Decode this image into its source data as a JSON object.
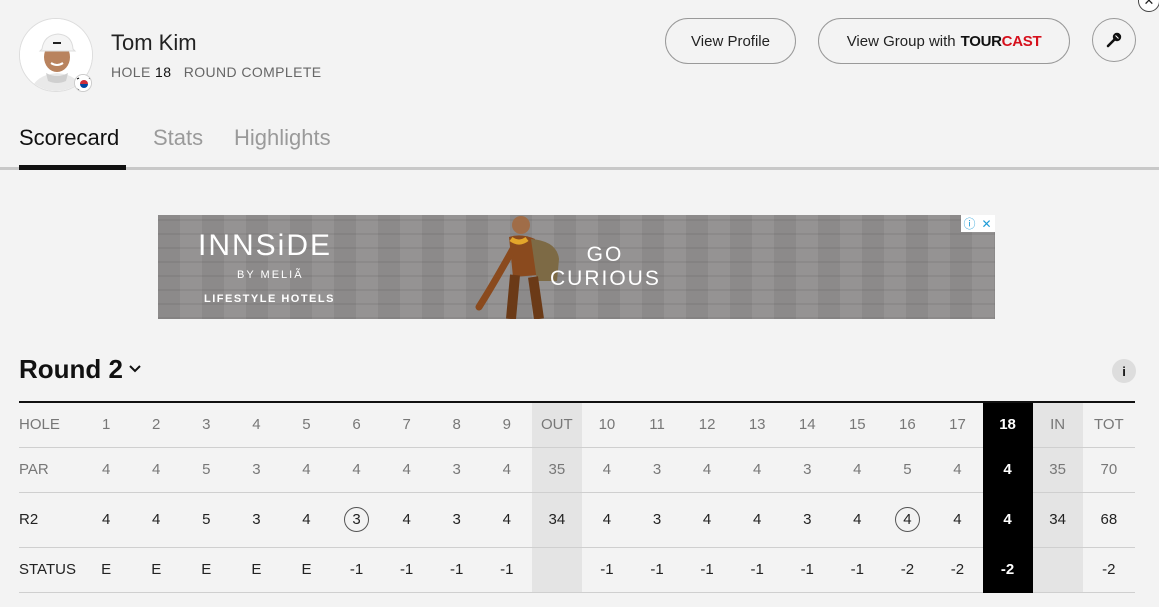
{
  "player": {
    "name": "Tom Kim",
    "hole_label": "HOLE",
    "hole_number": "18",
    "status": "ROUND COMPLETE"
  },
  "buttons": {
    "view_profile": "View Profile",
    "view_group": "View Group with",
    "tourcast_tour": "TOUR",
    "tourcast_cast": "CAST"
  },
  "tabs": [
    {
      "label": "Scorecard",
      "active": true
    },
    {
      "label": "Stats",
      "active": false
    },
    {
      "label": "Highlights",
      "active": false
    }
  ],
  "ad": {
    "brand": "INNSiDE",
    "by": "BY MELIÃ",
    "tagline": "LIFESTYLE HOTELS",
    "slogan": "GO CURIOUS"
  },
  "round": {
    "title": "Round 2"
  },
  "scorecard": {
    "holes": [
      "HOLE",
      "1",
      "2",
      "3",
      "4",
      "5",
      "6",
      "7",
      "8",
      "9",
      "OUT",
      "10",
      "11",
      "12",
      "13",
      "14",
      "15",
      "16",
      "17",
      "18",
      "IN",
      "TOT"
    ],
    "par": [
      "PAR",
      "4",
      "4",
      "5",
      "3",
      "4",
      "4",
      "4",
      "3",
      "4",
      "35",
      "4",
      "3",
      "4",
      "4",
      "3",
      "4",
      "5",
      "4",
      "4",
      "35",
      "70"
    ],
    "r2": [
      "R2",
      "4",
      "4",
      "5",
      "3",
      "4",
      "3",
      "4",
      "3",
      "4",
      "34",
      "4",
      "3",
      "4",
      "4",
      "3",
      "4",
      "4",
      "4",
      "4",
      "34",
      "68"
    ],
    "status": [
      "STATUS",
      "E",
      "E",
      "E",
      "E",
      "E",
      "-1",
      "-1",
      "-1",
      "-1",
      "",
      "-1",
      "-1",
      "-1",
      "-1",
      "-1",
      "-1",
      "-2",
      "-2",
      "-2",
      "",
      "-2"
    ],
    "birdie_holes": [
      "6",
      "16"
    ],
    "current_hole": "18"
  },
  "colors": {
    "accent_red": "#d6101c",
    "current_hole_bg": "#000000",
    "subtotal_bg": "#e4e4e4"
  }
}
